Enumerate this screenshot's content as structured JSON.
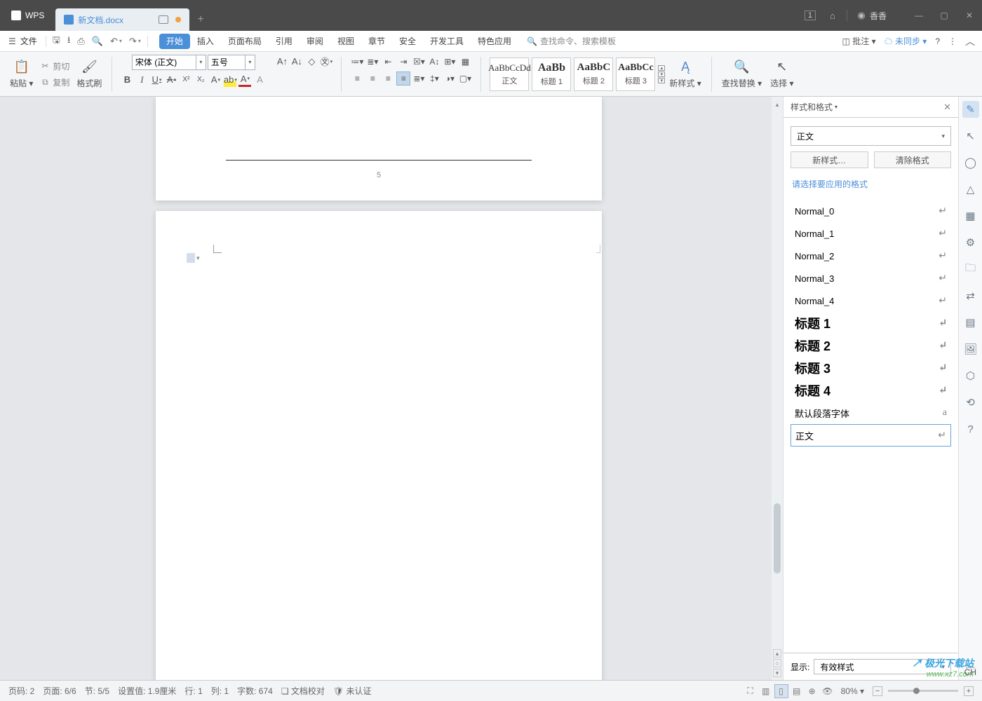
{
  "app": {
    "name": "WPS"
  },
  "tab": {
    "file": "新文档.docx"
  },
  "menu": {
    "file": "文件",
    "tabs": [
      "开始",
      "插入",
      "页面布局",
      "引用",
      "审阅",
      "视图",
      "章节",
      "安全",
      "开发工具",
      "特色应用"
    ],
    "search": "查找命令、搜索模板",
    "comments": "批注",
    "sync": "未同步"
  },
  "clipboard": {
    "paste": "粘贴",
    "cut": "剪切",
    "copy": "复制",
    "brush": "格式刷"
  },
  "font": {
    "name": "宋体 (正文)",
    "size": "五号"
  },
  "styles": {
    "gallery": [
      {
        "preview": "AaBbCcDd",
        "label": "正文"
      },
      {
        "preview": "AaBb",
        "label": "标题 1"
      },
      {
        "preview": "AaBbC",
        "label": "标题 2"
      },
      {
        "preview": "AaBbCc",
        "label": "标题 3"
      }
    ],
    "new": "新样式",
    "find": "查找替换",
    "select": "选择"
  },
  "panel": {
    "title": "样式和格式",
    "current": "正文",
    "newstyle": "新样式…",
    "clear": "清除格式",
    "hint": "请选择要应用的格式",
    "list": [
      {
        "name": "Normal_0",
        "kind": "normal"
      },
      {
        "name": "Normal_1",
        "kind": "normal"
      },
      {
        "name": "Normal_2",
        "kind": "normal"
      },
      {
        "name": "Normal_3",
        "kind": "normal"
      },
      {
        "name": "Normal_4",
        "kind": "normal"
      },
      {
        "name": "标题 1",
        "kind": "heading"
      },
      {
        "name": "标题 2",
        "kind": "heading"
      },
      {
        "name": "标题 3",
        "kind": "heading"
      },
      {
        "name": "标题 4",
        "kind": "heading"
      },
      {
        "name": "默认段落字体",
        "kind": "normal",
        "glyph": "a"
      },
      {
        "name": "正文",
        "kind": "normal",
        "selected": true
      }
    ],
    "show_label": "显示:",
    "show_value": "有效样式"
  },
  "page": {
    "number": "5"
  },
  "status": {
    "page_no": "页码: 2",
    "page": "页面: 6/6",
    "section": "节: 5/5",
    "pos": "设置值: 1.9厘米",
    "row": "行: 1",
    "col": "列: 1",
    "words": "字数: 674",
    "proof": "文档校对",
    "auth": "未认证",
    "zoom": "80%",
    "lang": "CH"
  },
  "titlebar": {
    "badge": "1",
    "user": "香香"
  },
  "watermark": {
    "l1": "↗ 极光下载站",
    "l2": "www.xz7.com"
  }
}
